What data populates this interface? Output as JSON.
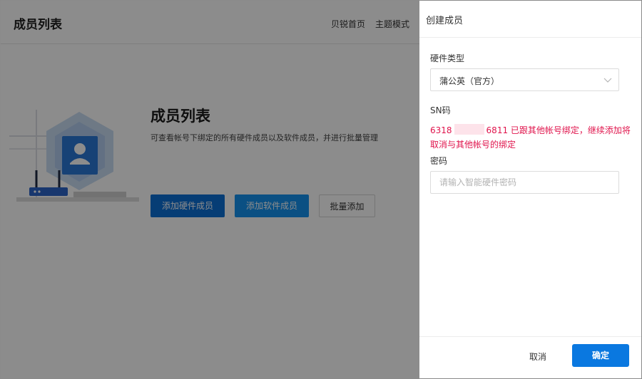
{
  "header": {
    "app_title": "成员列表",
    "nav": [
      "贝锐首页",
      "主题模式"
    ]
  },
  "hero": {
    "title": "成员列表",
    "description": "可查看帐号下绑定的所有硬件成员以及软件成员，并进行批量管理",
    "buttons": {
      "add_hardware": "添加硬件成员",
      "add_software": "添加软件成员",
      "batch_add": "批量添加"
    }
  },
  "drawer": {
    "title": "创建成员",
    "hardware_type": {
      "label": "硬件类型",
      "value": "蒲公英（官方）"
    },
    "sn": {
      "label": "SN码",
      "prefix": "6318",
      "suffix": "6811",
      "error_line1": "已跟其他帐号绑定，继续添加将",
      "error_line2": "取消与其他帐号的绑定"
    },
    "password": {
      "label": "密码",
      "placeholder": "请输入智能硬件密码"
    },
    "footer": {
      "cancel": "取消",
      "confirm": "确定"
    }
  },
  "colors": {
    "primary": "#0a78e0",
    "error": "#e0144c"
  }
}
